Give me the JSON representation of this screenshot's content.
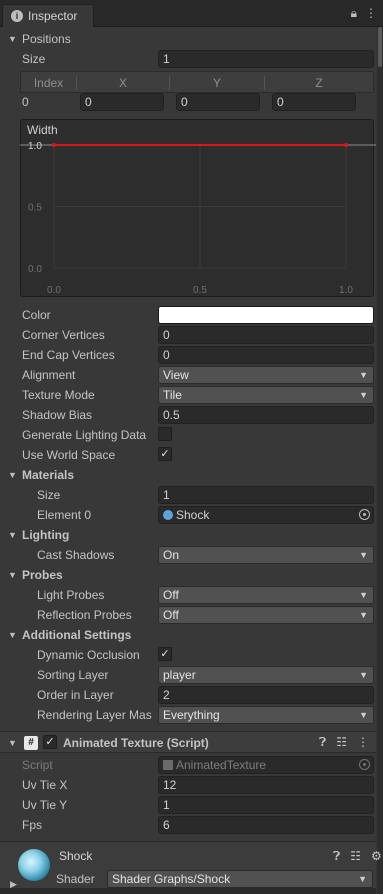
{
  "window": {
    "tab_title": "Inspector",
    "lock_icon": "lock-icon",
    "menu_icon": "kebab-menu-icon"
  },
  "positions": {
    "title": "Positions",
    "size_label": "Size",
    "size_value": "1",
    "columns": [
      "Index",
      "X",
      "Y",
      "Z"
    ],
    "row": {
      "index": "0",
      "x": "0",
      "y": "0",
      "z": "0"
    }
  },
  "width_curve": {
    "title": "Width",
    "y_ticks": [
      "1.0",
      "0.5",
      "0.0"
    ],
    "x_ticks": [
      "0.0",
      "0.5",
      "1.0"
    ]
  },
  "chart_data": {
    "type": "line",
    "title": "Width",
    "xlabel": "",
    "ylabel": "",
    "xlim": [
      0,
      1
    ],
    "ylim": [
      0,
      1
    ],
    "series": [
      {
        "x": [
          0,
          1
        ],
        "y": [
          1.0,
          1.0
        ]
      }
    ],
    "color": "#d31919"
  },
  "line_props": [
    {
      "label": "Color",
      "kind": "color",
      "value": "#ffffff"
    },
    {
      "label": "Corner Vertices",
      "kind": "text",
      "value": "0"
    },
    {
      "label": "End Cap Vertices",
      "kind": "text",
      "value": "0"
    },
    {
      "label": "Alignment",
      "kind": "dropdown",
      "value": "View"
    },
    {
      "label": "Texture Mode",
      "kind": "dropdown",
      "value": "Tile"
    },
    {
      "label": "Shadow Bias",
      "kind": "text",
      "value": "0.5"
    },
    {
      "label": "Generate Lighting Data",
      "kind": "check",
      "value": false
    },
    {
      "label": "Use World Space",
      "kind": "check",
      "value": true
    }
  ],
  "materials": {
    "title": "Materials",
    "size_label": "Size",
    "size_value": "1",
    "element_label": "Element 0",
    "element_value": "Shock"
  },
  "lighting": {
    "title": "Lighting",
    "cast_label": "Cast Shadows",
    "cast_value": "On"
  },
  "probes": {
    "title": "Probes",
    "light_label": "Light Probes",
    "light_value": "Off",
    "reflection_label": "Reflection Probes",
    "reflection_value": "Off"
  },
  "additional": {
    "title": "Additional Settings",
    "dynamic_label": "Dynamic Occlusion",
    "sorting_label": "Sorting Layer",
    "sorting_value": "player",
    "order_label": "Order in Layer",
    "order_value": "2",
    "rendering_label": "Rendering Layer Mas",
    "rendering_value": "Everything"
  },
  "script_component": {
    "title": "Animated Texture (Script)",
    "script_label": "Script",
    "script_value": "AnimatedTexture",
    "uvx_label": "Uv Tie X",
    "uvx_value": "12",
    "uvy_label": "Uv Tie Y",
    "uvy_value": "1",
    "fps_label": "Fps",
    "fps_value": "6"
  },
  "material_footer": {
    "name": "Shock",
    "shader_label": "Shader",
    "shader_value": "Shader Graphs/Shock"
  }
}
